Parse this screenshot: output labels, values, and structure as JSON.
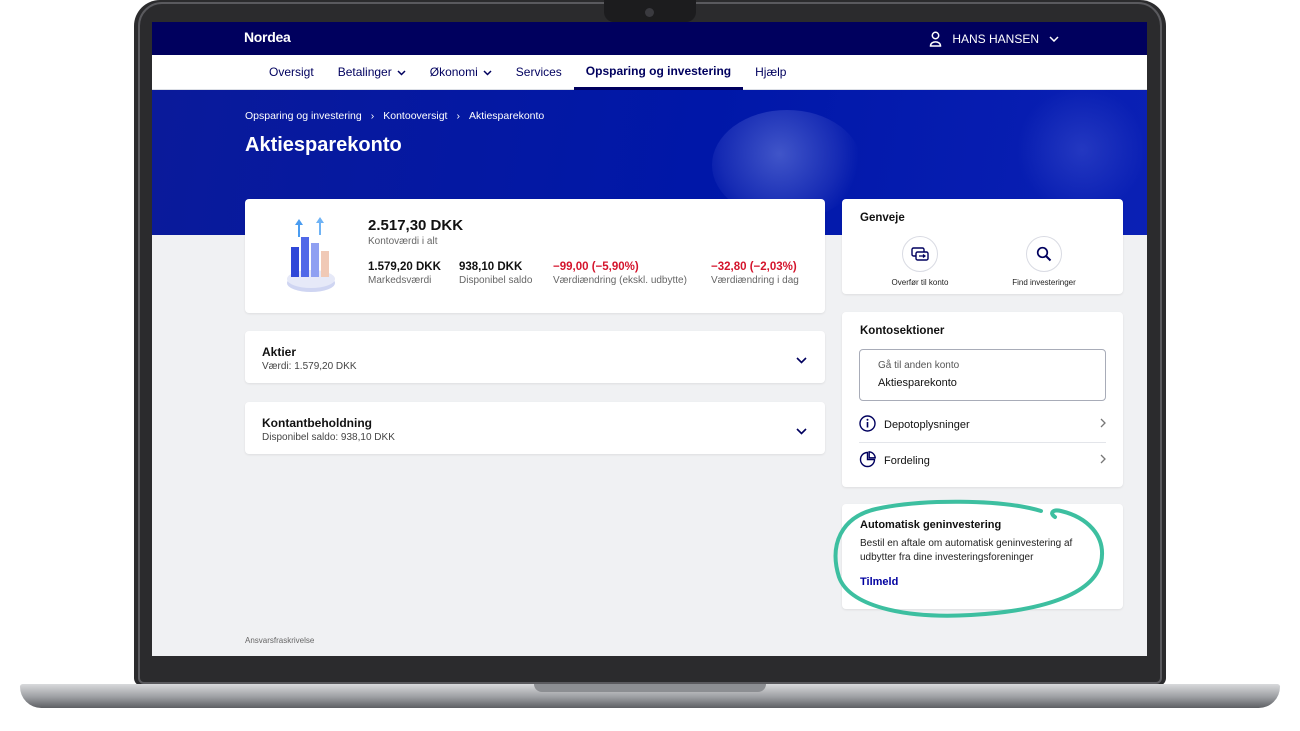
{
  "app": {
    "logo": "Nordea"
  },
  "user": {
    "name": "HANS HANSEN"
  },
  "nav": {
    "items": [
      {
        "label": "Oversigt",
        "dropdown": false,
        "active": false
      },
      {
        "label": "Betalinger",
        "dropdown": true,
        "active": false
      },
      {
        "label": "Økonomi",
        "dropdown": true,
        "active": false
      },
      {
        "label": "Services",
        "dropdown": false,
        "active": false
      },
      {
        "label": "Opsparing og investering",
        "dropdown": false,
        "active": true
      },
      {
        "label": "Hjælp",
        "dropdown": false,
        "active": false
      }
    ]
  },
  "breadcrumb": [
    "Opsparing og investering",
    "Kontooversigt",
    "Aktiesparekonto"
  ],
  "page": {
    "title": "Aktiesparekonto"
  },
  "summary": {
    "total_value": "2.517,30 DKK",
    "total_label": "Kontoværdi i alt",
    "stats": [
      {
        "value": "1.579,20 DKK",
        "label": "Markedsværdi",
        "negative": false
      },
      {
        "value": "938,10 DKK",
        "label": "Disponibel saldo",
        "negative": false
      },
      {
        "value": "−99,00 (−5,90%)",
        "label": "Værdiændring (ekskl. udbytte)",
        "negative": true
      },
      {
        "value": "−32,80 (−2,03%)",
        "label": "Værdiændring i dag",
        "negative": true
      }
    ]
  },
  "accordions": [
    {
      "title": "Aktier",
      "subtitle": "Værdi: 1.579,20 DKK"
    },
    {
      "title": "Kontantbeholdning",
      "subtitle": "Disponibel saldo: 938,10 DKK"
    }
  ],
  "shortcuts": {
    "title": "Genveje",
    "items": [
      {
        "label": "Overfør til konto",
        "icon": "transfer-icon"
      },
      {
        "label": "Find investeringer",
        "icon": "search-icon"
      }
    ]
  },
  "account_sections": {
    "title": "Kontosektioner",
    "select": {
      "placeholder": "Gå til anden konto",
      "value": "Aktiesparekonto"
    },
    "links": [
      {
        "label": "Depotoplysninger",
        "icon": "info-icon"
      },
      {
        "label": "Fordeling",
        "icon": "pie-chart-icon"
      }
    ]
  },
  "auto_reinvest": {
    "title": "Automatisk geninvestering",
    "description": "Bestil en aftale om automatisk geninvestering af udbytter fra dine investeringsforeninger",
    "cta": "Tilmeld"
  },
  "footer": {
    "disclaimer": "Ansvarsfraskrivelse"
  },
  "colors": {
    "brand": "#00005e",
    "hero": "#0017a8",
    "negative": "#d4142c",
    "highlight": "#3dbfa0"
  }
}
